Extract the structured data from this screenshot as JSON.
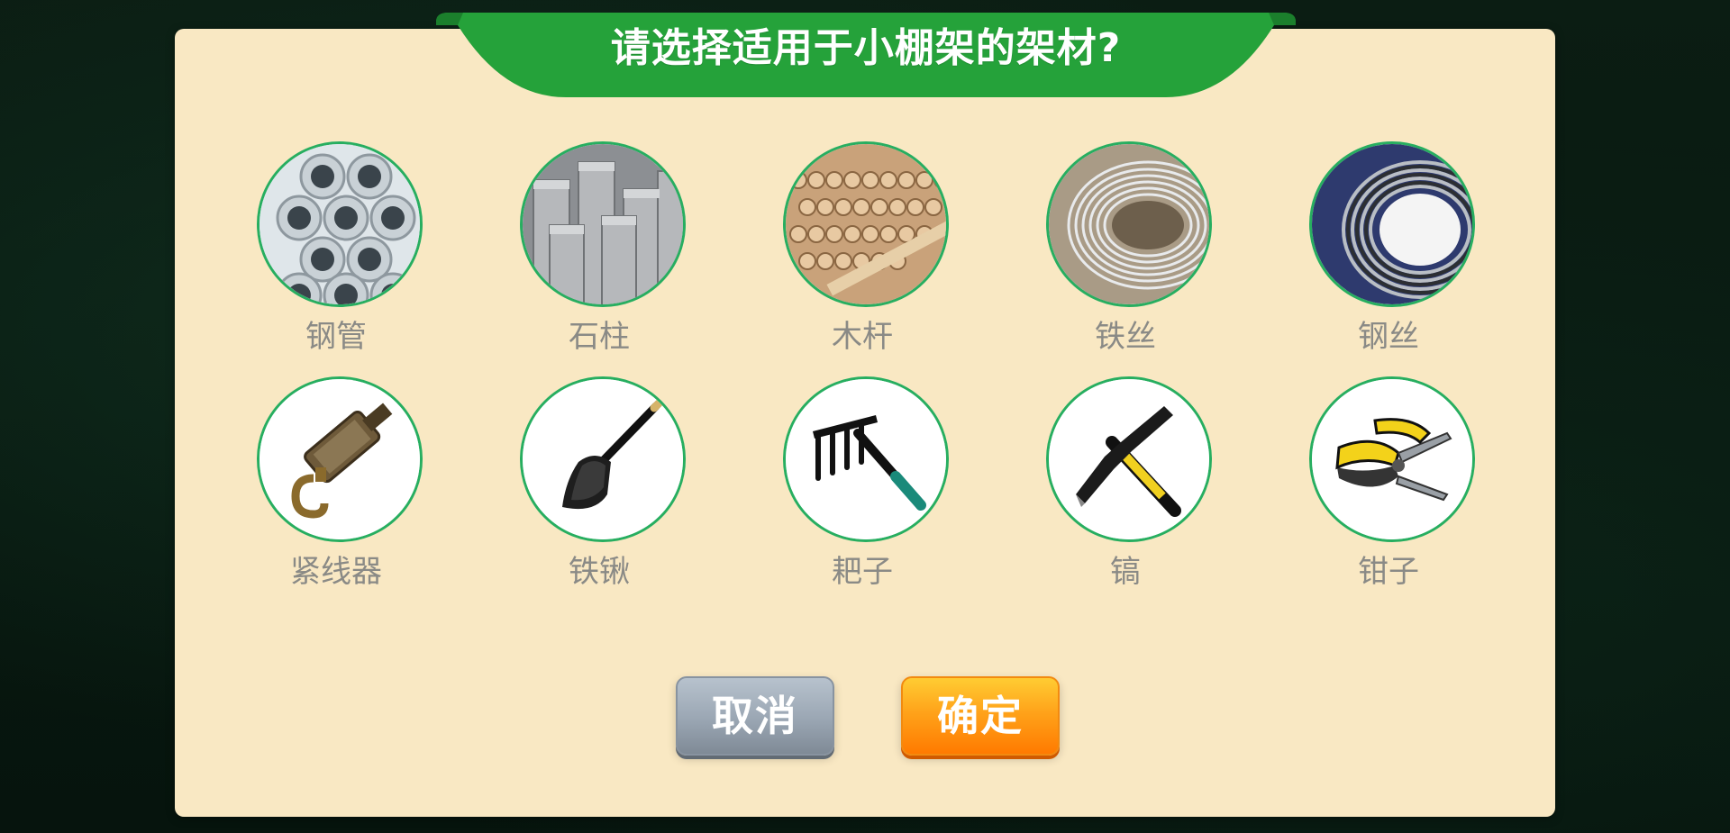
{
  "dialog": {
    "title": "请选择适用于小棚架的架材?"
  },
  "options": [
    {
      "label": "钢管",
      "icon": "steel-pipe-icon"
    },
    {
      "label": "石柱",
      "icon": "stone-pillar-icon"
    },
    {
      "label": "木杆",
      "icon": "wooden-pole-icon"
    },
    {
      "label": "铁丝",
      "icon": "iron-wire-icon"
    },
    {
      "label": "钢丝",
      "icon": "steel-wire-icon"
    },
    {
      "label": "紧线器",
      "icon": "wire-tightener-icon"
    },
    {
      "label": "铁锹",
      "icon": "shovel-icon"
    },
    {
      "label": "耙子",
      "icon": "rake-icon"
    },
    {
      "label": "镐",
      "icon": "pickaxe-icon"
    },
    {
      "label": "钳子",
      "icon": "pliers-icon"
    }
  ],
  "buttons": {
    "cancel": "取消",
    "confirm": "确定"
  },
  "colors": {
    "panel_bg": "#f9e8c3",
    "banner_green": "#25a23a",
    "circle_border": "#27ae60",
    "label_gray": "#8a8a86",
    "cancel_gray": "#9aa6b3",
    "confirm_orange": "#ff9a1a"
  }
}
